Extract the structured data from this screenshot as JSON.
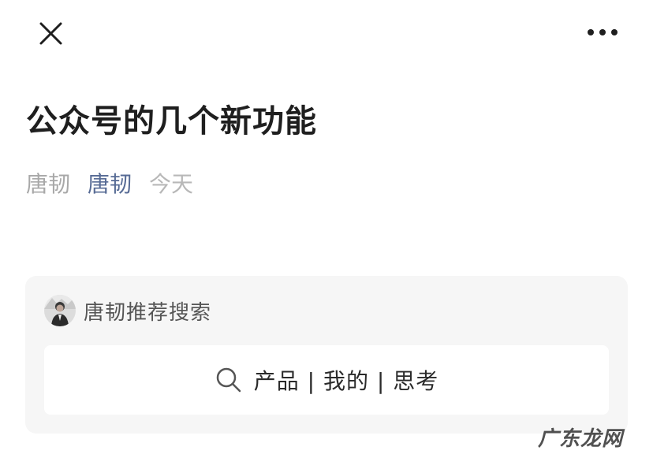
{
  "toolbar": {
    "close_icon": "close-icon",
    "more_icon": "more-dots-icon"
  },
  "article": {
    "title": "公众号的几个新功能",
    "author": "唐韧",
    "account_name": "唐韧",
    "date": "今天"
  },
  "search_card": {
    "header": "唐韧推荐搜索",
    "avatar_icon": "avatar",
    "search_icon": "search-icon",
    "query": "产品 | 我的 | 思考"
  },
  "watermark": {
    "text": "广东龙网"
  },
  "colors": {
    "title": "#1f1f1f",
    "author": "#a8a8a8",
    "account_link": "#576b95",
    "date": "#b8b8b8",
    "card_background": "#f6f6f6"
  }
}
